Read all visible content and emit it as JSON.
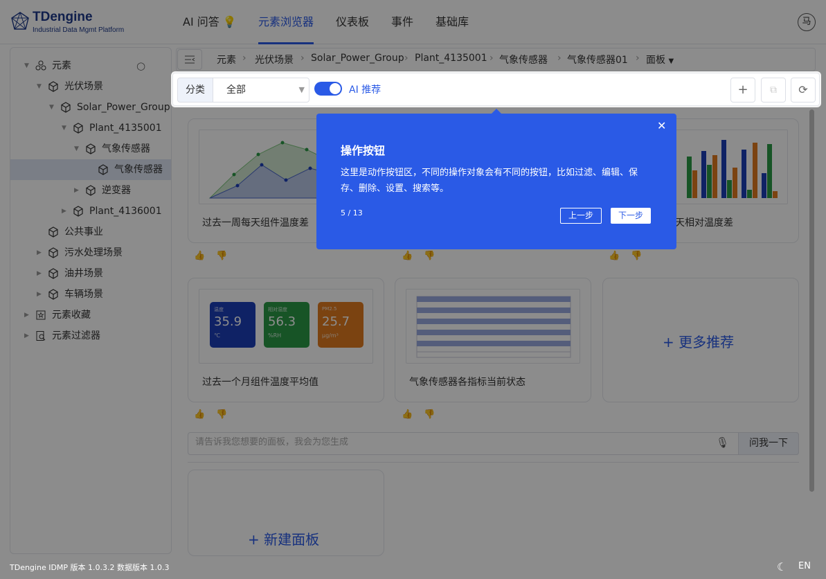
{
  "header": {
    "logo_title": "TDengine",
    "logo_subtitle": "Industrial Data Mgmt Platform",
    "nav": [
      "AI 问答",
      "元素浏览器",
      "仪表板",
      "事件",
      "基础库"
    ],
    "active_nav": "元素浏览器",
    "avatar_text": "马"
  },
  "sidebar": {
    "root": "元素",
    "items": [
      {
        "label": "光伏场景",
        "level": 1,
        "expanded": true
      },
      {
        "label": "Solar_Power_Group",
        "level": 2,
        "expanded": true
      },
      {
        "label": "Plant_4135001",
        "level": 3,
        "expanded": true
      },
      {
        "label": "气象传感器",
        "level": 4,
        "expanded": true
      },
      {
        "label": "气象传感器",
        "level": 5,
        "selected": true
      },
      {
        "label": "逆变器",
        "level": 4,
        "expanded": false
      },
      {
        "label": "Plant_4136001",
        "level": 3,
        "expanded": false
      },
      {
        "label": "公共事业",
        "level": 1
      },
      {
        "label": "污水处理场景",
        "level": 1,
        "expanded": false
      },
      {
        "label": "油井场景",
        "level": 1,
        "expanded": false
      },
      {
        "label": "车辆场景",
        "level": 1,
        "expanded": false
      }
    ],
    "favorites": "元素收藏",
    "filters": "元素过滤器"
  },
  "breadcrumb": [
    "元素",
    "光伏场景",
    "Solar_Power_Group",
    "Plant_4135001",
    "气象传感器",
    "气象传感器01",
    "面板"
  ],
  "toolbar": {
    "filter_label": "分类",
    "filter_value": "全部",
    "ai_toggle_label": "AI 推荐",
    "ai_toggle_on": true
  },
  "cards": [
    {
      "title": "过去一周每天组件温度差"
    },
    {
      "title": "天相对温度差"
    },
    {
      "title": "过去一个月组件温度平均值",
      "tiles": [
        {
          "name": "温度",
          "value": "35.9",
          "unit": "℃",
          "color": "#1d3fb8"
        },
        {
          "name": "相对湿度",
          "value": "56.3",
          "unit": "%RH",
          "color": "#2b9a46"
        },
        {
          "name": "PM2.5",
          "value": "25.7",
          "unit": "μg/m³",
          "color": "#e07b1f"
        }
      ]
    },
    {
      "title": "气象传感器各指标当前状态"
    },
    {
      "title": "更多推荐"
    }
  ],
  "prompt": {
    "placeholder": "请告诉我您想要的面板，我会为您生成",
    "ask_label": "问我一下"
  },
  "new_panel_label": "新建面板",
  "footer": {
    "version": "TDengine IDMP 版本 1.0.3.2 数据版本 1.0.3",
    "lang": "EN"
  },
  "tour": {
    "title": "操作按钮",
    "body": "这里是动作按钮区，不同的操作对象会有不同的按钮，比如过滤、编辑、保存、删除、设置、搜索等。",
    "step": "5 / 13",
    "prev_label": "上一步",
    "next_label": "下一步"
  },
  "colors": {
    "accent": "#2a5ae6",
    "chart_blue": "#1d3fb8",
    "chart_green": "#2b9a46",
    "chart_orange": "#e07b1f"
  }
}
